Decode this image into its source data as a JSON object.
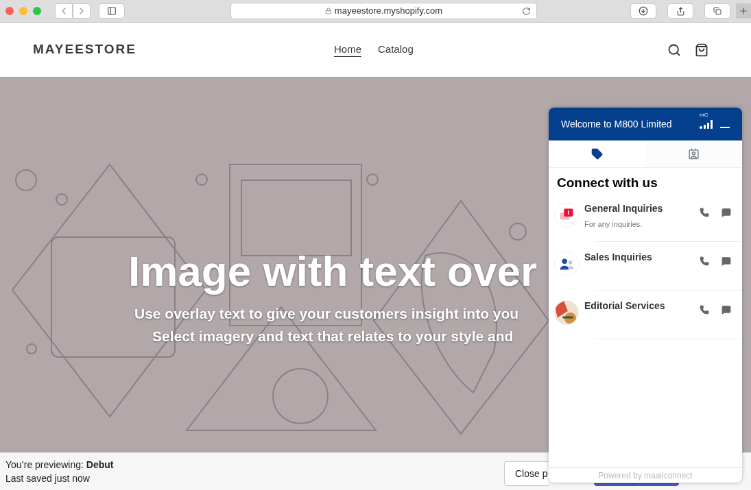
{
  "browser": {
    "url": "mayeestore.myshopify.com"
  },
  "store": {
    "logo": "MAYEESTORE",
    "nav": [
      {
        "label": "Home",
        "selected": true
      },
      {
        "label": "Catalog",
        "selected": false
      }
    ]
  },
  "hero": {
    "kind": "picture",
    "heading": "Image with text over",
    "lines": [
      "Use overlay text to give your customers insight into you",
      "Select imagery and text that relates to your style and"
    ]
  },
  "preview_bar": {
    "prefix": "You’re previewing: ",
    "theme": "Debut",
    "saved": "Last saved just now",
    "close_button": "Close p"
  },
  "widget": {
    "title": "Welcome to M800 Limited",
    "brand_mark": "mC",
    "tabs": [
      {
        "kind": "tag",
        "selected": true
      },
      {
        "kind": "contacts",
        "selected": false
      }
    ],
    "heading": "Connect with us",
    "items": [
      {
        "kind": "info",
        "title": "General Inquiries",
        "subtitle": "For any inquiries."
      },
      {
        "kind": "people",
        "title": "Sales Inquiries"
      },
      {
        "kind": "editorial",
        "title": "Editorial Services"
      }
    ],
    "footer": "Powered by maaiiconnect"
  }
}
